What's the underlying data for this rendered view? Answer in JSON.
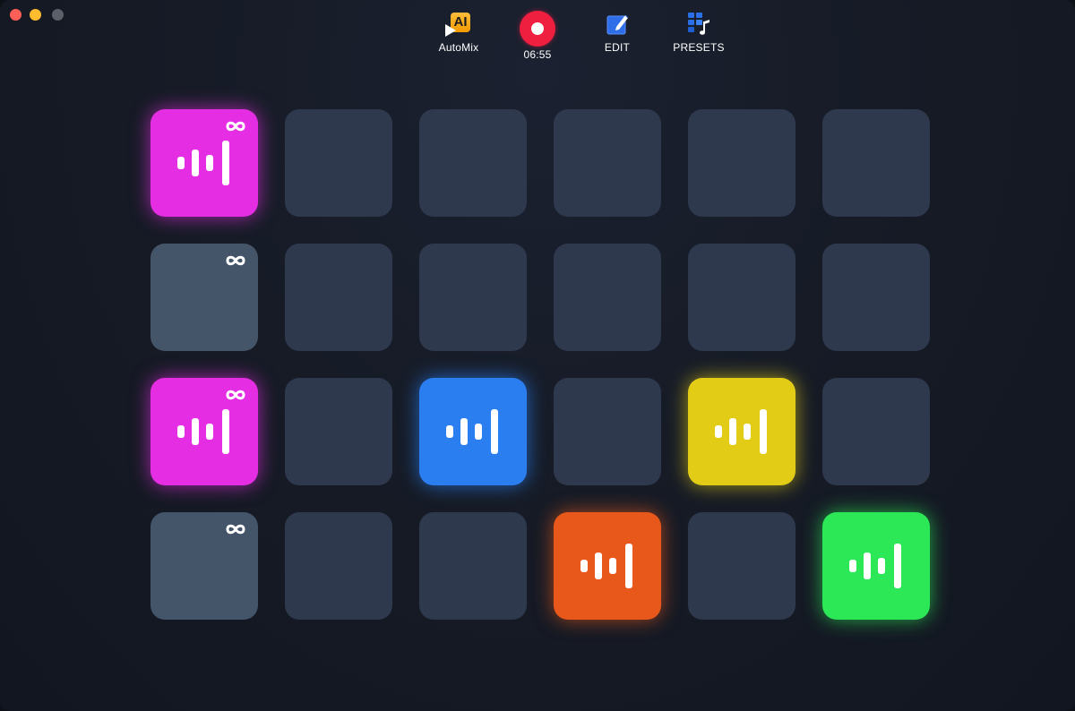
{
  "window": {
    "traffic_lights": [
      "close",
      "minimize",
      "maximize"
    ]
  },
  "toolbar": {
    "automix_badge": "AI",
    "automix_label": "AutoMix",
    "record_time": "06:55",
    "edit_label": "EDIT",
    "presets_label": "PRESETS"
  },
  "colors": {
    "background": "#161b26",
    "pad_empty": "#2e394e",
    "pad_loop_idle": "#445469",
    "magenta": "#e52ee3",
    "blue": "#2a7ef0",
    "yellow": "#e2cc16",
    "orange": "#e8581a",
    "green": "#2ce857",
    "record": "#ee1f3f"
  },
  "pads": [
    [
      {
        "state": "active",
        "color": "magenta",
        "icon": "waveform-icon",
        "loop": true
      },
      {
        "state": "empty"
      },
      {
        "state": "empty"
      },
      {
        "state": "empty"
      },
      {
        "state": "empty"
      },
      {
        "state": "empty"
      }
    ],
    [
      {
        "state": "idle",
        "loop": true
      },
      {
        "state": "empty"
      },
      {
        "state": "empty"
      },
      {
        "state": "empty"
      },
      {
        "state": "empty"
      },
      {
        "state": "empty"
      }
    ],
    [
      {
        "state": "active",
        "color": "magenta",
        "icon": "waveform-icon",
        "loop": true
      },
      {
        "state": "empty"
      },
      {
        "state": "active",
        "color": "blue",
        "icon": "waveform-icon",
        "loop": false
      },
      {
        "state": "empty"
      },
      {
        "state": "active",
        "color": "yellow",
        "icon": "waveform-icon",
        "loop": false
      },
      {
        "state": "empty"
      }
    ],
    [
      {
        "state": "idle",
        "loop": true
      },
      {
        "state": "empty"
      },
      {
        "state": "empty"
      },
      {
        "state": "active",
        "color": "orange",
        "icon": "waveform-icon",
        "loop": false
      },
      {
        "state": "empty"
      },
      {
        "state": "active",
        "color": "green",
        "icon": "waveform-icon",
        "loop": false
      }
    ]
  ]
}
